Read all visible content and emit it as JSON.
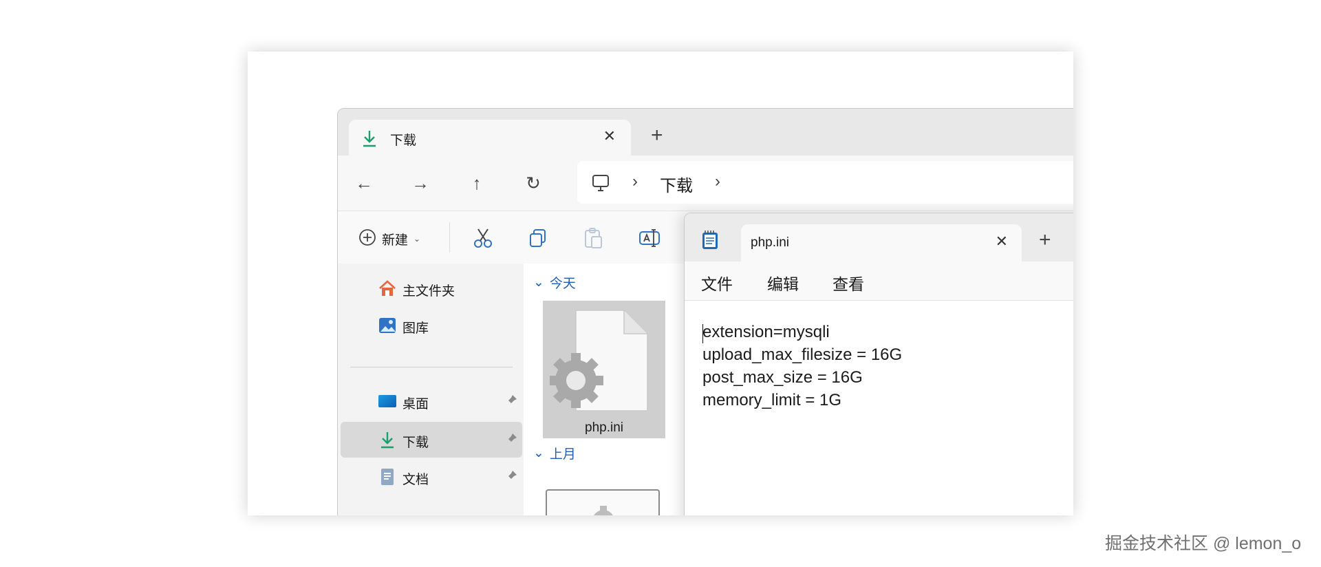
{
  "explorer": {
    "tab_title": "下载",
    "tab_close": "✕",
    "new_tab": "+",
    "nav": {
      "back": "←",
      "forward": "→",
      "up": "↑",
      "refresh": "↻"
    },
    "breadcrumb": {
      "sep1": "›",
      "folder": "下载",
      "sep2": "›"
    },
    "toolbar": {
      "new_label": "新建",
      "new_caret": "⌄"
    },
    "sidebar": {
      "items": [
        {
          "label": "主文件夹",
          "icon": "home-icon"
        },
        {
          "label": "图库",
          "icon": "gallery-icon"
        },
        {
          "label": "桌面",
          "icon": "desktop-icon",
          "pinned": true
        },
        {
          "label": "下载",
          "icon": "download-icon",
          "pinned": true,
          "selected": true
        },
        {
          "label": "文档",
          "icon": "document-icon",
          "pinned": true
        }
      ]
    },
    "groups": {
      "today": "今天",
      "last_month": "上月",
      "chevron": "⌄"
    },
    "files": {
      "today_file": "php.ini"
    }
  },
  "notepad": {
    "tab_title": "php.ini",
    "tab_close": "✕",
    "new_tab": "+",
    "menu": {
      "file": "文件",
      "edit": "编辑",
      "view": "查看"
    },
    "lines": [
      "extension=mysqli",
      "upload_max_filesize = 16G",
      "post_max_size = 16G",
      "memory_limit = 1G"
    ]
  },
  "watermark": "掘金技术社区 @ lemon_o",
  "colors": {
    "accent_blue": "#205fb3",
    "download_green": "#1a9e6e"
  }
}
